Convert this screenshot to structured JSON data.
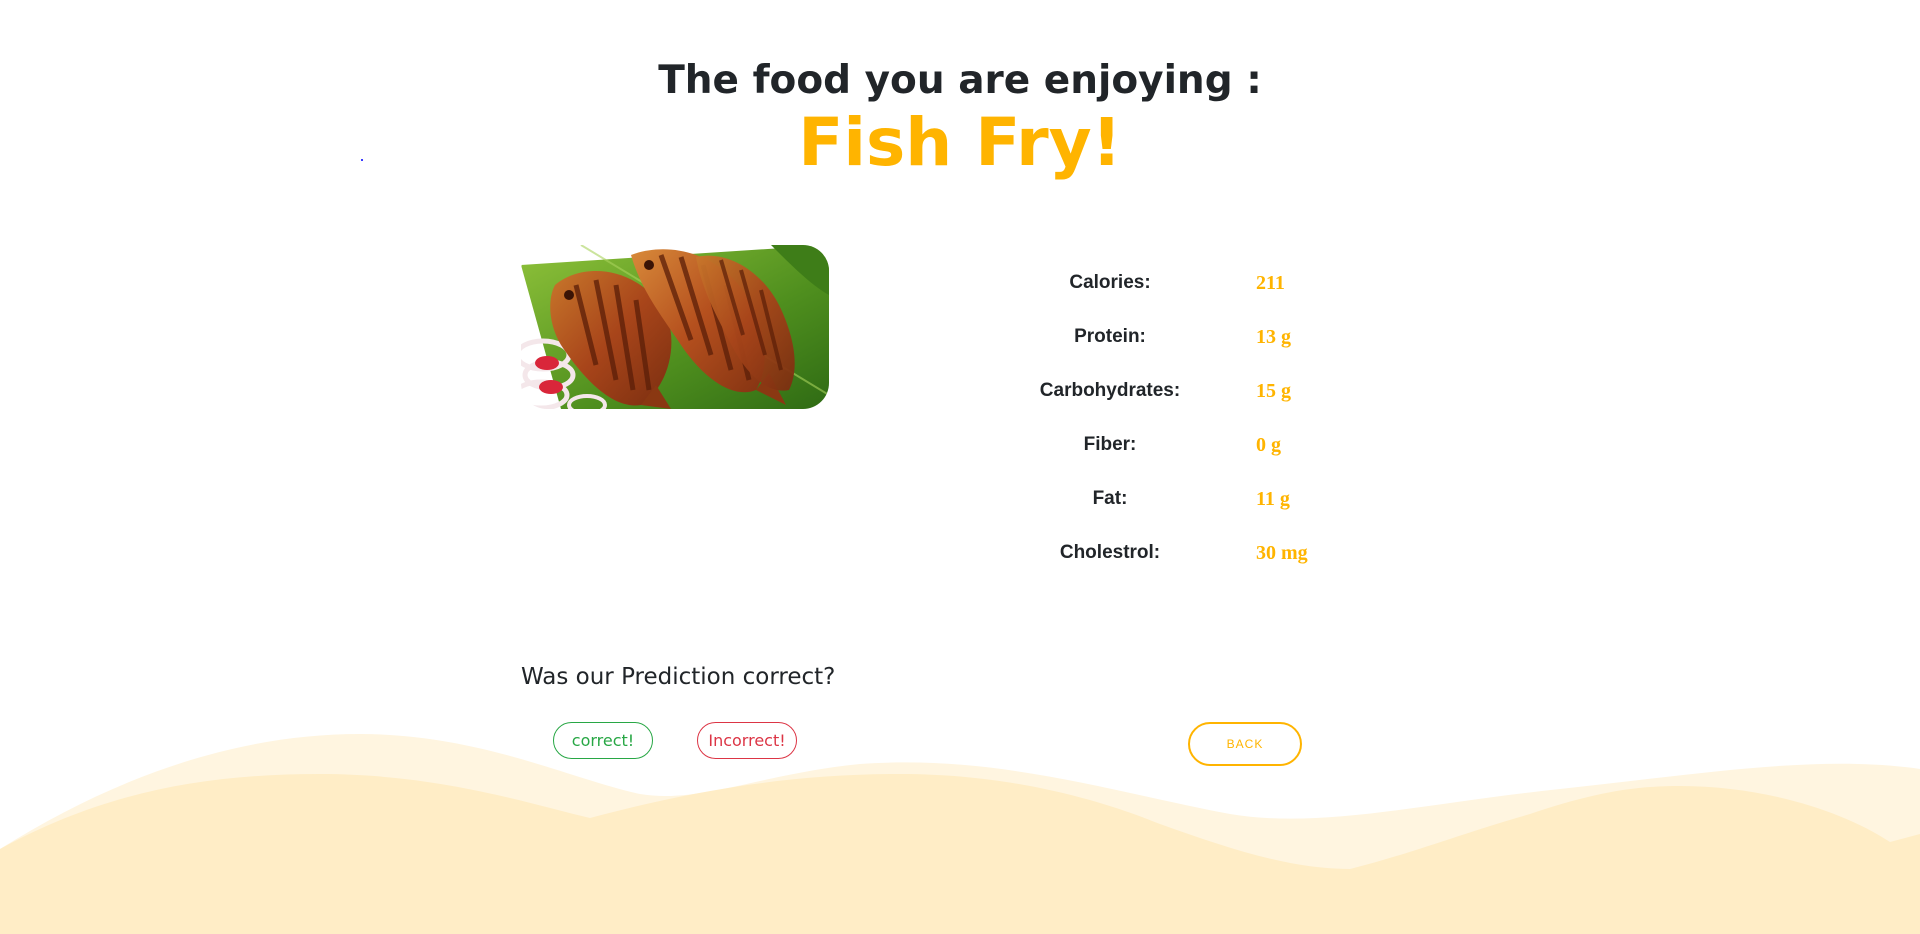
{
  "page": {
    "heading": "The food you are enjoying :",
    "dish_name": "Fish Fry!"
  },
  "food_image": {
    "alt": "Fish Fry"
  },
  "nutrition": [
    {
      "label": "Calories:",
      "value": "211"
    },
    {
      "label": "Protein:",
      "value": "13 g"
    },
    {
      "label": "Carbohydrates:",
      "value": "15 g"
    },
    {
      "label": "Fiber:",
      "value": "0 g"
    },
    {
      "label": "Fat:",
      "value": "11 g"
    },
    {
      "label": "Cholestrol:",
      "value": "30 mg"
    }
  ],
  "feedback": {
    "question": "Was our Prediction correct?",
    "correct_label": "correct!",
    "incorrect_label": "Incorrect!",
    "back_label": "BACK"
  },
  "colors": {
    "accent": "#ffb400",
    "text": "#212529",
    "correct": "#28a745",
    "incorrect": "#dc3545",
    "wave_light": "#fff5e0",
    "wave_main": "#ffedc6"
  }
}
